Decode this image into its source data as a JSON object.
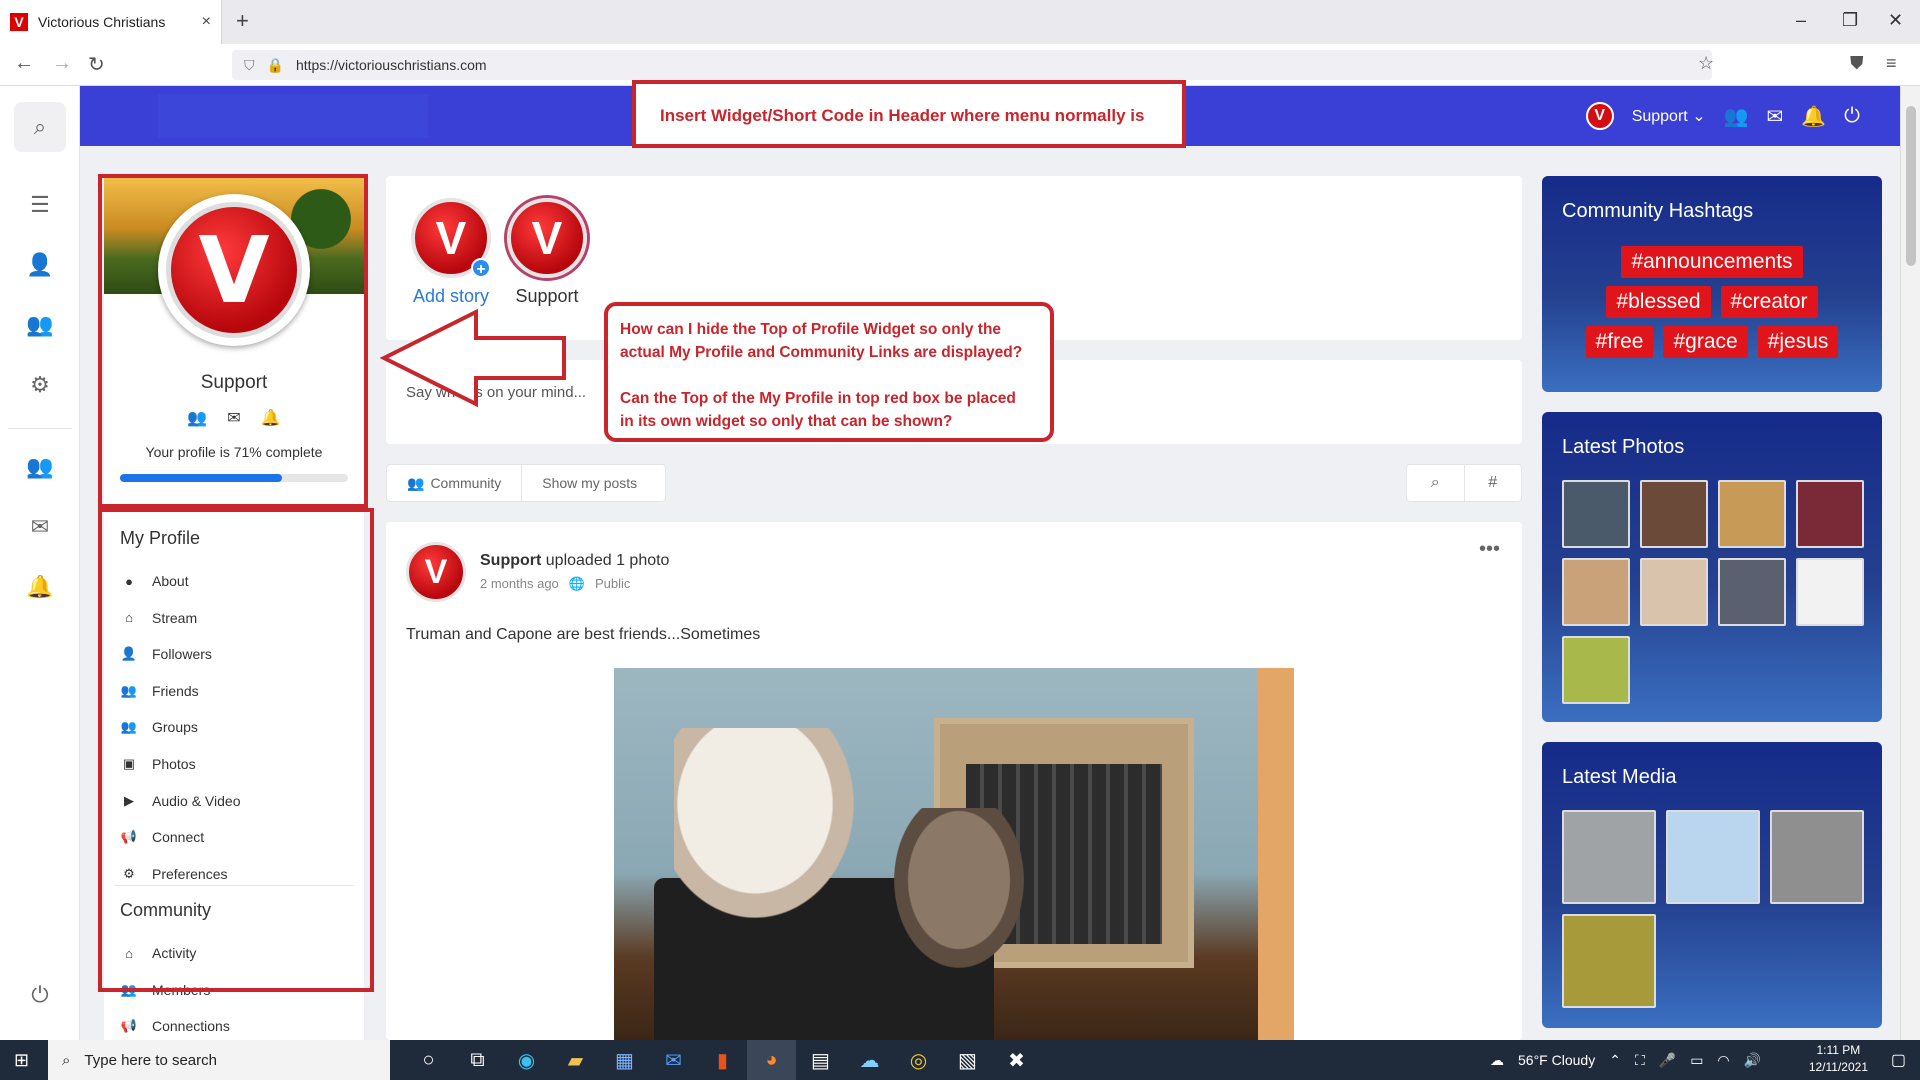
{
  "browser": {
    "tab_title": "Victorious Christians",
    "tab_favicon": "V",
    "tab_close": "×",
    "new_tab": "+",
    "url": "https://victoriouschristians.com",
    "window_controls": [
      "–",
      "❐",
      "✕"
    ]
  },
  "header": {
    "support_label": "Support",
    "logo_letter": "V"
  },
  "annotations": {
    "top_note": "Insert Widget/Short Code in Header where menu normally is",
    "question_line1": "How can I hide the Top of Profile Widget so only the",
    "question_line2": "actual My Profile and Community Links are displayed?",
    "question_line3": "Can the Top of the My Profile in top red box be placed",
    "question_line4": "in its own widget so only that can be shown?"
  },
  "profile": {
    "name": "Support",
    "avatar_letter": "V",
    "completion_text": "Your profile is 71% complete",
    "completion_percent": 71
  },
  "menu": {
    "my_profile_heading": "My Profile",
    "my_profile_items": [
      {
        "label": "About",
        "icon": "user-circle-icon",
        "glyph": "●"
      },
      {
        "label": "Stream",
        "icon": "home-icon",
        "glyph": "⌂"
      },
      {
        "label": "Followers",
        "icon": "user-check-icon",
        "glyph": "👤"
      },
      {
        "label": "Friends",
        "icon": "users-icon",
        "glyph": "👥"
      },
      {
        "label": "Groups",
        "icon": "user-group-icon",
        "glyph": "👥"
      },
      {
        "label": "Photos",
        "icon": "camera-icon",
        "glyph": "▣"
      },
      {
        "label": "Audio & Video",
        "icon": "video-icon",
        "glyph": "▶"
      },
      {
        "label": "Connect",
        "icon": "megaphone-icon",
        "glyph": "📢"
      },
      {
        "label": "Preferences",
        "icon": "gear-icon",
        "glyph": "⚙"
      }
    ],
    "community_heading": "Community",
    "community_items": [
      {
        "label": "Activity",
        "icon": "home-icon",
        "glyph": "⌂"
      },
      {
        "label": "Members",
        "icon": "users-icon",
        "glyph": "👥"
      },
      {
        "label": "Connections",
        "icon": "megaphone-icon",
        "glyph": "📢"
      }
    ]
  },
  "stories": {
    "add_label": "Add story",
    "user_label": "Support",
    "avatar_letter": "V"
  },
  "composer": {
    "placeholder": "Say what is on your mind..."
  },
  "filters": {
    "community_label": "Community",
    "my_posts_label": "Show my posts"
  },
  "post": {
    "author": "Support",
    "action": "uploaded 1 photo",
    "time": "2 months ago",
    "privacy": "Public",
    "text": "Truman and Capone are best friends...Sometimes",
    "more": "•••",
    "avatar_letter": "V"
  },
  "widgets": {
    "hashtags_title": "Community Hashtags",
    "hashtags": [
      "#announcements",
      "#blessed",
      "#creator",
      "#free",
      "#grace",
      "#jesus"
    ],
    "photos_title": "Latest Photos",
    "photo_count": 9,
    "media_title": "Latest Media",
    "media_count": 4
  },
  "colors": {
    "header_blue": "#3a3fd6",
    "brand_red": "#d40d12",
    "annotation_red": "#c9252c",
    "hashtag_red": "#e0151b",
    "progress_blue": "#1a73e8"
  },
  "taskbar": {
    "search_placeholder": "Type here to search",
    "weather": "56°F Cloudy",
    "time": "1:11 PM",
    "date": "12/11/2021"
  }
}
